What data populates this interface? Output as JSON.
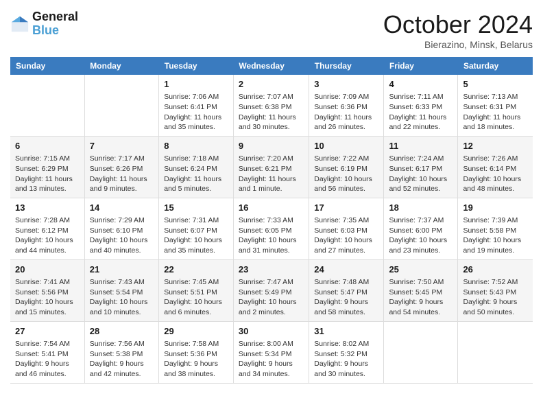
{
  "header": {
    "logo_line1": "General",
    "logo_line2": "Blue",
    "month_title": "October 2024",
    "location": "Bierazino, Minsk, Belarus"
  },
  "days_of_week": [
    "Sunday",
    "Monday",
    "Tuesday",
    "Wednesday",
    "Thursday",
    "Friday",
    "Saturday"
  ],
  "weeks": [
    [
      {
        "day": "",
        "info": ""
      },
      {
        "day": "",
        "info": ""
      },
      {
        "day": "1",
        "info": "Sunrise: 7:06 AM\nSunset: 6:41 PM\nDaylight: 11 hours and 35 minutes."
      },
      {
        "day": "2",
        "info": "Sunrise: 7:07 AM\nSunset: 6:38 PM\nDaylight: 11 hours and 30 minutes."
      },
      {
        "day": "3",
        "info": "Sunrise: 7:09 AM\nSunset: 6:36 PM\nDaylight: 11 hours and 26 minutes."
      },
      {
        "day": "4",
        "info": "Sunrise: 7:11 AM\nSunset: 6:33 PM\nDaylight: 11 hours and 22 minutes."
      },
      {
        "day": "5",
        "info": "Sunrise: 7:13 AM\nSunset: 6:31 PM\nDaylight: 11 hours and 18 minutes."
      }
    ],
    [
      {
        "day": "6",
        "info": "Sunrise: 7:15 AM\nSunset: 6:29 PM\nDaylight: 11 hours and 13 minutes."
      },
      {
        "day": "7",
        "info": "Sunrise: 7:17 AM\nSunset: 6:26 PM\nDaylight: 11 hours and 9 minutes."
      },
      {
        "day": "8",
        "info": "Sunrise: 7:18 AM\nSunset: 6:24 PM\nDaylight: 11 hours and 5 minutes."
      },
      {
        "day": "9",
        "info": "Sunrise: 7:20 AM\nSunset: 6:21 PM\nDaylight: 11 hours and 1 minute."
      },
      {
        "day": "10",
        "info": "Sunrise: 7:22 AM\nSunset: 6:19 PM\nDaylight: 10 hours and 56 minutes."
      },
      {
        "day": "11",
        "info": "Sunrise: 7:24 AM\nSunset: 6:17 PM\nDaylight: 10 hours and 52 minutes."
      },
      {
        "day": "12",
        "info": "Sunrise: 7:26 AM\nSunset: 6:14 PM\nDaylight: 10 hours and 48 minutes."
      }
    ],
    [
      {
        "day": "13",
        "info": "Sunrise: 7:28 AM\nSunset: 6:12 PM\nDaylight: 10 hours and 44 minutes."
      },
      {
        "day": "14",
        "info": "Sunrise: 7:29 AM\nSunset: 6:10 PM\nDaylight: 10 hours and 40 minutes."
      },
      {
        "day": "15",
        "info": "Sunrise: 7:31 AM\nSunset: 6:07 PM\nDaylight: 10 hours and 35 minutes."
      },
      {
        "day": "16",
        "info": "Sunrise: 7:33 AM\nSunset: 6:05 PM\nDaylight: 10 hours and 31 minutes."
      },
      {
        "day": "17",
        "info": "Sunrise: 7:35 AM\nSunset: 6:03 PM\nDaylight: 10 hours and 27 minutes."
      },
      {
        "day": "18",
        "info": "Sunrise: 7:37 AM\nSunset: 6:00 PM\nDaylight: 10 hours and 23 minutes."
      },
      {
        "day": "19",
        "info": "Sunrise: 7:39 AM\nSunset: 5:58 PM\nDaylight: 10 hours and 19 minutes."
      }
    ],
    [
      {
        "day": "20",
        "info": "Sunrise: 7:41 AM\nSunset: 5:56 PM\nDaylight: 10 hours and 15 minutes."
      },
      {
        "day": "21",
        "info": "Sunrise: 7:43 AM\nSunset: 5:54 PM\nDaylight: 10 hours and 10 minutes."
      },
      {
        "day": "22",
        "info": "Sunrise: 7:45 AM\nSunset: 5:51 PM\nDaylight: 10 hours and 6 minutes."
      },
      {
        "day": "23",
        "info": "Sunrise: 7:47 AM\nSunset: 5:49 PM\nDaylight: 10 hours and 2 minutes."
      },
      {
        "day": "24",
        "info": "Sunrise: 7:48 AM\nSunset: 5:47 PM\nDaylight: 9 hours and 58 minutes."
      },
      {
        "day": "25",
        "info": "Sunrise: 7:50 AM\nSunset: 5:45 PM\nDaylight: 9 hours and 54 minutes."
      },
      {
        "day": "26",
        "info": "Sunrise: 7:52 AM\nSunset: 5:43 PM\nDaylight: 9 hours and 50 minutes."
      }
    ],
    [
      {
        "day": "27",
        "info": "Sunrise: 7:54 AM\nSunset: 5:41 PM\nDaylight: 9 hours and 46 minutes."
      },
      {
        "day": "28",
        "info": "Sunrise: 7:56 AM\nSunset: 5:38 PM\nDaylight: 9 hours and 42 minutes."
      },
      {
        "day": "29",
        "info": "Sunrise: 7:58 AM\nSunset: 5:36 PM\nDaylight: 9 hours and 38 minutes."
      },
      {
        "day": "30",
        "info": "Sunrise: 8:00 AM\nSunset: 5:34 PM\nDaylight: 9 hours and 34 minutes."
      },
      {
        "day": "31",
        "info": "Sunrise: 8:02 AM\nSunset: 5:32 PM\nDaylight: 9 hours and 30 minutes."
      },
      {
        "day": "",
        "info": ""
      },
      {
        "day": "",
        "info": ""
      }
    ]
  ]
}
